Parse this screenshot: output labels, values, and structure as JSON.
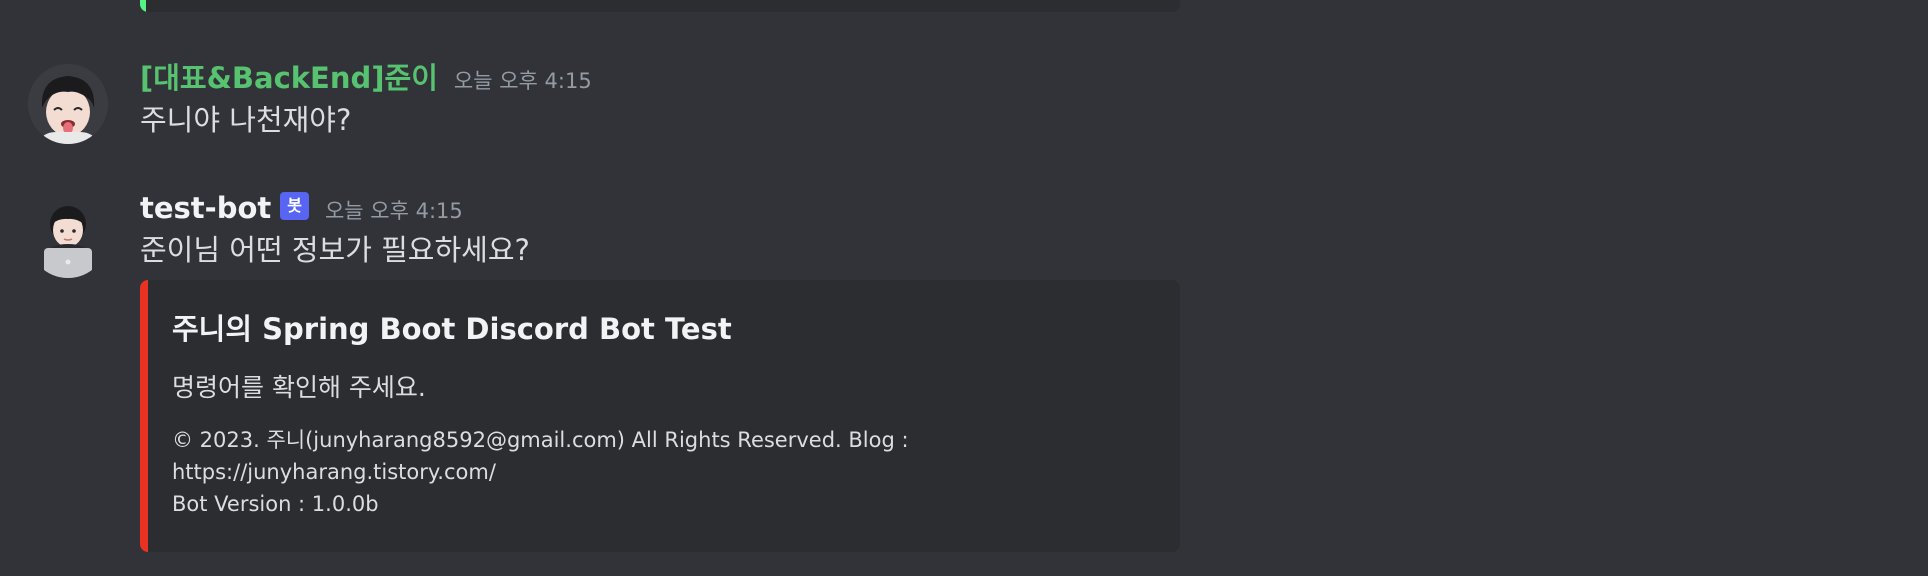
{
  "previous_embed": {
    "accent_color": "#57f287"
  },
  "messages": [
    {
      "author": "[대표&BackEnd]준이",
      "author_color": "#57c26f",
      "timestamp": "오늘 오후 4:15",
      "content": "주니야 나천재야?",
      "avatar_icon": "memoji-avatar-icon"
    },
    {
      "author": "test-bot",
      "author_color": "#f2f3f5",
      "bot_tag": "봇",
      "timestamp": "오늘 오후 4:15",
      "content": "준이님 어떤 정보가 필요하세요?",
      "avatar_icon": "memoji-laptop-avatar-icon",
      "embed": {
        "accent_color": "#e83323",
        "title": "주니의 Spring Boot Discord Bot Test",
        "description": "명령어를 확인해 주세요.",
        "footer": "© 2023. 주니(junyharang8592@gmail.com) All Rights Reserved. Blog : https://junyharang.tistory.com/\n Bot Version : 1.0.0b"
      }
    }
  ]
}
